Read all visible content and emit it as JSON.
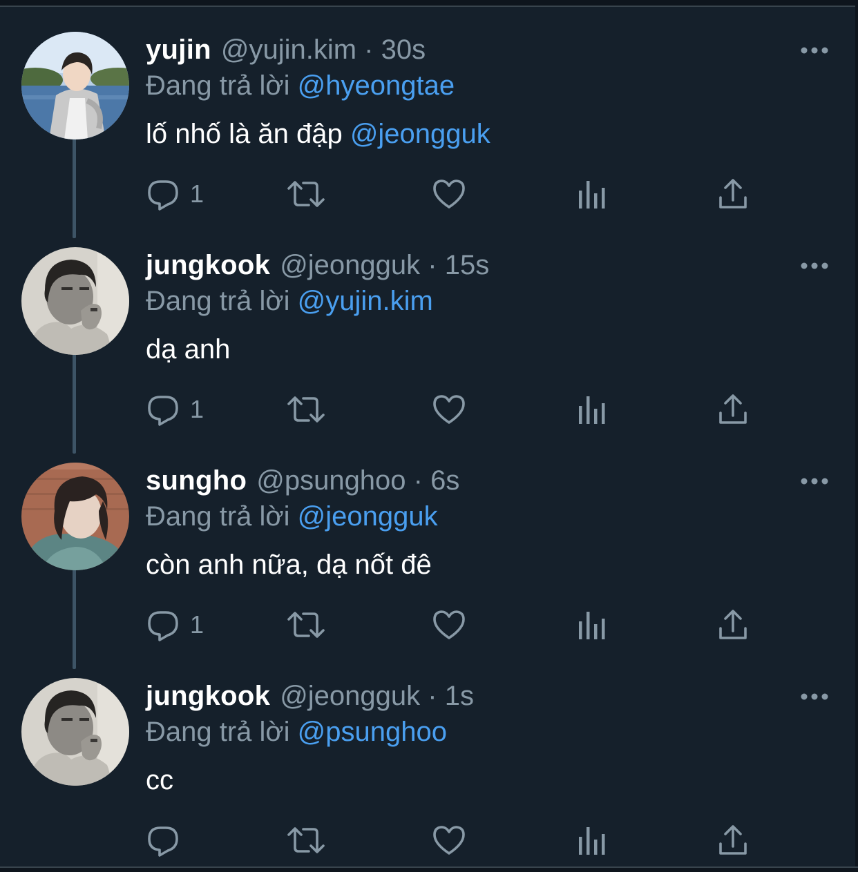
{
  "colors": {
    "background": "#15202b",
    "muted": "#8899a6",
    "mention": "#4a9ff0",
    "thread_line": "#3d5466",
    "text": "#ffffff"
  },
  "tweets": [
    {
      "name": "yujin",
      "meta": "@yujin.kim · 30s",
      "reply_prefix": "Đang trả lời",
      "reply_to": "@hyeongtae",
      "text": "lố nhố là ăn đập",
      "text_mention": "@jeongguk",
      "reply_count": "1",
      "avatar": "photo-avatar-lake",
      "icons": [
        "reply-icon",
        "retweet-icon",
        "like-icon",
        "analytics-icon",
        "share-icon",
        "more-icon"
      ]
    },
    {
      "name": "jungkook",
      "meta": "@jeongguk · 15s",
      "reply_prefix": "Đang trả lời",
      "reply_to": "@yujin.kim",
      "text": "dạ anh",
      "text_mention": "",
      "reply_count": "1",
      "avatar": "photo-avatar-monochrome",
      "icons": [
        "reply-icon",
        "retweet-icon",
        "like-icon",
        "analytics-icon",
        "share-icon",
        "more-icon"
      ]
    },
    {
      "name": "sungho",
      "meta": "@psunghoo · 6s",
      "reply_prefix": "Đang trả lời",
      "reply_to": "@jeongguk",
      "text": "còn anh nữa, dạ nốt đê",
      "text_mention": "",
      "reply_count": "1",
      "avatar": "photo-avatar-brick",
      "icons": [
        "reply-icon",
        "retweet-icon",
        "like-icon",
        "analytics-icon",
        "share-icon",
        "more-icon"
      ]
    },
    {
      "name": "jungkook",
      "meta": "@jeongguk · 1s",
      "reply_prefix": "Đang trả lời",
      "reply_to": "@psunghoo",
      "text": "cc",
      "text_mention": "",
      "reply_count": "",
      "avatar": "photo-avatar-monochrome",
      "icons": [
        "reply-icon",
        "retweet-icon",
        "like-icon",
        "analytics-icon",
        "share-icon",
        "more-icon"
      ]
    }
  ]
}
